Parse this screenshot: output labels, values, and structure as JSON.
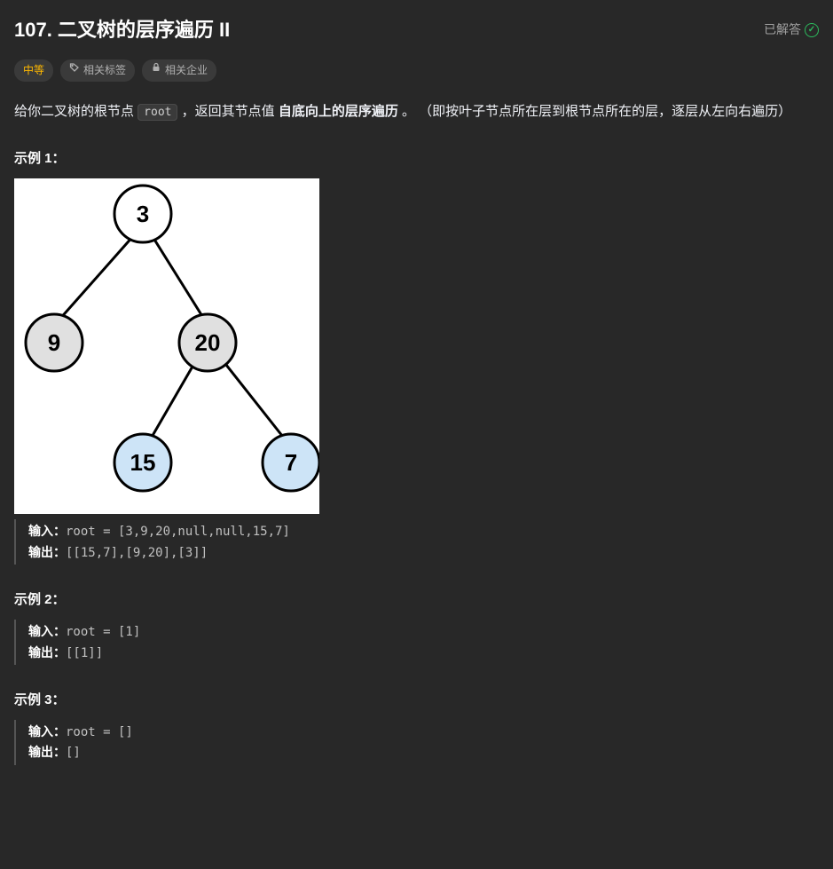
{
  "header": {
    "title": "107. 二叉树的层序遍历 II",
    "solved_label": "已解答"
  },
  "tags": {
    "difficulty": "中等",
    "related_tags": "相关标签",
    "related_companies": "相关企业"
  },
  "description": {
    "part1": "给你二叉树的根节点 ",
    "code": "root",
    "part2": " ，返回其节点值 ",
    "bold": "自底向上的层序遍历",
    "part3": " 。 （即按叶子节点所在层到根节点所在的层，逐层从左向右遍历）"
  },
  "tree": {
    "n1": "3",
    "n2": "9",
    "n3": "20",
    "n4": "15",
    "n5": "7"
  },
  "examples": [
    {
      "label": "示例 1：",
      "input_label": "输入：",
      "input_value": "root = [3,9,20,null,null,15,7]",
      "output_label": "输出：",
      "output_value": "[[15,7],[9,20],[3]]",
      "has_tree": true
    },
    {
      "label": "示例 2：",
      "input_label": "输入：",
      "input_value": "root = [1]",
      "output_label": "输出：",
      "output_value": "[[1]]",
      "has_tree": false
    },
    {
      "label": "示例 3：",
      "input_label": "输入：",
      "input_value": "root = []",
      "output_label": "输出：",
      "output_value": "[]",
      "has_tree": false
    }
  ]
}
